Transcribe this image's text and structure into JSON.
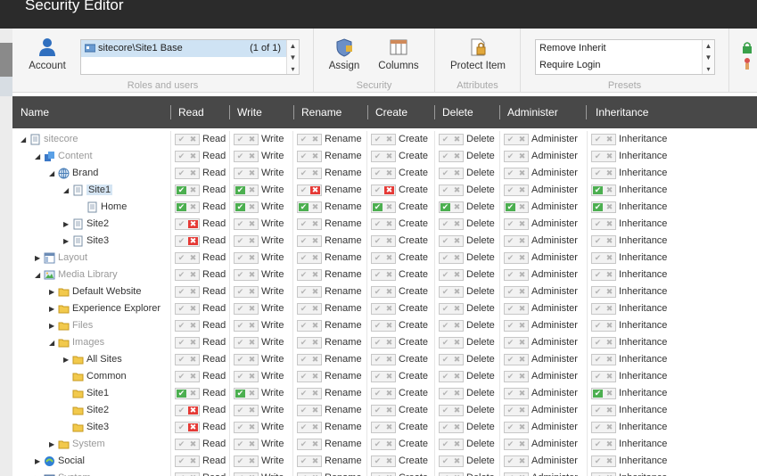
{
  "window": {
    "title": "Security Editor"
  },
  "ribbon": {
    "account_label": "Account",
    "roles_list": {
      "selected": "sitecore\\Site1 Base",
      "count": "(1 of 1)"
    },
    "roles_caption": "Roles and users",
    "assign_label": "Assign",
    "columns_label": "Columns",
    "security_caption": "Security",
    "protect_label": "Protect Item",
    "attributes_caption": "Attributes",
    "presets": [
      "Remove Inherit",
      "Require Login"
    ],
    "presets_caption": "Presets"
  },
  "columns": [
    "Name",
    "Read",
    "Write",
    "Rename",
    "Create",
    "Delete",
    "Administer",
    "Inheritance"
  ],
  "colors": {
    "allow": "#4caf50",
    "deny": "#e53935",
    "header": "#484848",
    "titlebar": "#2b2b2b"
  },
  "rows": [
    {
      "name": "sitecore",
      "depth": 0,
      "arrow": "expanded",
      "icon": "page-icon",
      "gray": true,
      "p": "nnnnnnn"
    },
    {
      "name": "Content",
      "depth": 1,
      "arrow": "expanded",
      "icon": "content-icon",
      "gray": true,
      "p": "nnnnnnn"
    },
    {
      "name": "Brand",
      "depth": 2,
      "arrow": "expanded",
      "icon": "globe-icon",
      "gray": false,
      "p": "nnnnnnn"
    },
    {
      "name": "Site1",
      "depth": 3,
      "arrow": "expanded",
      "icon": "page-icon",
      "gray": false,
      "selected": true,
      "p": "aaddnna"
    },
    {
      "name": "Home",
      "depth": 4,
      "arrow": "none",
      "icon": "page-icon",
      "gray": false,
      "p": "aaaaaaa"
    },
    {
      "name": "Site2",
      "depth": 3,
      "arrow": "collapsed",
      "icon": "page-icon",
      "gray": false,
      "p": "dnnnnnn"
    },
    {
      "name": "Site3",
      "depth": 3,
      "arrow": "collapsed",
      "icon": "page-icon",
      "gray": false,
      "p": "dnnnnnn"
    },
    {
      "name": "Layout",
      "depth": 1,
      "arrow": "collapsed",
      "icon": "layout-icon",
      "gray": true,
      "p": "nnnnnnn"
    },
    {
      "name": "Media Library",
      "depth": 1,
      "arrow": "expanded",
      "icon": "image-icon",
      "gray": true,
      "p": "nnnnnnn"
    },
    {
      "name": "Default Website",
      "depth": 2,
      "arrow": "collapsed",
      "icon": "folder-icon",
      "gray": false,
      "p": "nnnnnnn"
    },
    {
      "name": "Experience Explorer",
      "depth": 2,
      "arrow": "collapsed",
      "icon": "folder-icon",
      "gray": false,
      "p": "nnnnnnn"
    },
    {
      "name": "Files",
      "depth": 2,
      "arrow": "collapsed",
      "icon": "folder-icon",
      "gray": true,
      "p": "nnnnnnn"
    },
    {
      "name": "Images",
      "depth": 2,
      "arrow": "expanded",
      "icon": "folder-icon",
      "gray": true,
      "p": "nnnnnnn"
    },
    {
      "name": "All Sites",
      "depth": 3,
      "arrow": "collapsed",
      "icon": "folder-icon",
      "gray": false,
      "p": "nnnnnnn"
    },
    {
      "name": "Common",
      "depth": 3,
      "arrow": "none",
      "icon": "folder-icon",
      "gray": false,
      "p": "nnnnnnn"
    },
    {
      "name": "Site1",
      "depth": 3,
      "arrow": "none",
      "icon": "folder-icon",
      "gray": false,
      "p": "aannnna"
    },
    {
      "name": "Site2",
      "depth": 3,
      "arrow": "none",
      "icon": "folder-icon",
      "gray": false,
      "p": "dnnnnnn"
    },
    {
      "name": "Site3",
      "depth": 3,
      "arrow": "none",
      "icon": "folder-icon",
      "gray": false,
      "p": "dnnnnnn"
    },
    {
      "name": "System",
      "depth": 2,
      "arrow": "collapsed",
      "icon": "folder-icon",
      "gray": true,
      "p": "nnnnnnn"
    },
    {
      "name": "Social",
      "depth": 1,
      "arrow": "collapsed",
      "icon": "social-icon",
      "gray": false,
      "p": "nnnnnnn"
    },
    {
      "name": "System",
      "depth": 1,
      "arrow": "collapsed",
      "icon": "system-icon",
      "gray": true,
      "p": "nnnnnnn"
    }
  ]
}
